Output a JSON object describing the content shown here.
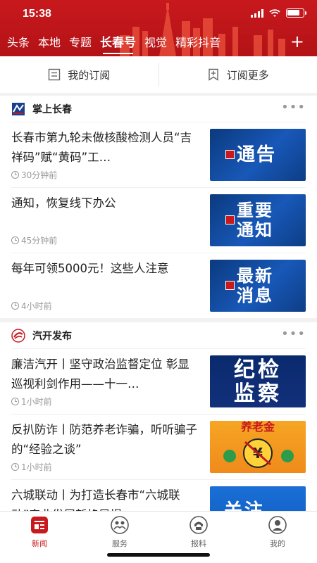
{
  "status_bar": {
    "time": "15:38",
    "battery_level": 0.85
  },
  "top_tabs": [
    {
      "label": "头条",
      "active": false
    },
    {
      "label": "本地",
      "active": false
    },
    {
      "label": "专题",
      "active": false
    },
    {
      "label": "长春号",
      "active": true
    },
    {
      "label": "视觉",
      "active": false
    },
    {
      "label": "精彩抖音",
      "active": false
    }
  ],
  "add_tab_label": "+",
  "subscribe_bar": {
    "my_subscriptions": "我的订阅",
    "subscribe_more": "订阅更多"
  },
  "sections": [
    {
      "name": "掌上长春",
      "items": [
        {
          "title": "长春市第九轮未做核酸检测人员“吉祥码”赋“黄码”工…",
          "time": "30分钟前",
          "thumb_text": [
            "通告"
          ]
        },
        {
          "title": "通知，恢复线下办公",
          "time": "45分钟前",
          "thumb_text": [
            "重要",
            "通知"
          ]
        },
        {
          "title": "每年可领5000元！这些人注意",
          "time": "4小时前",
          "thumb_text": [
            "最新",
            "消息"
          ]
        }
      ]
    },
    {
      "name": "汽开发布",
      "items": [
        {
          "title": "廉洁汽开丨坚守政治监督定位 彰显巡视利剑作用——十一…",
          "time": "1小时前",
          "thumb_text": [
            "纪检",
            "监察"
          ]
        },
        {
          "title": "反扒防诈丨防范养老诈骗，听听骗子的“经验之谈”",
          "time": "1小时前",
          "thumb_text": [
            "养老金"
          ]
        },
        {
          "title": "六城联动丨为打造长春市“六城联动”产业发展新格局提…",
          "time": "",
          "thumb_text": [
            "关注"
          ]
        }
      ]
    }
  ],
  "bottom_nav": [
    {
      "label": "新闻",
      "active": true
    },
    {
      "label": "服务",
      "active": false
    },
    {
      "label": "报料",
      "active": false
    },
    {
      "label": "我的",
      "active": false
    }
  ],
  "colors": {
    "brand_red": "#c8191d",
    "notice_blue": "#1858b8"
  }
}
